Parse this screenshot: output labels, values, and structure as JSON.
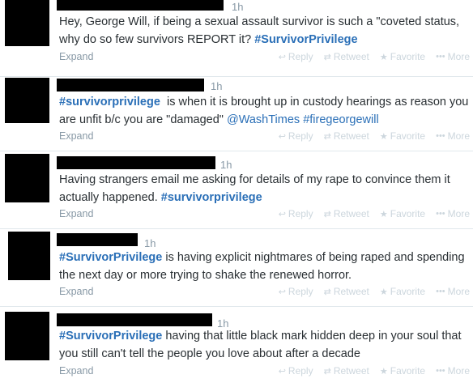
{
  "actions": {
    "reply": "Reply",
    "retweet": "Retweet",
    "favorite": "Favorite",
    "more": "More",
    "expand": "Expand"
  },
  "tweets": [
    {
      "time": "1h",
      "parts": [
        {
          "t": "Hey, George Will, if being a sexual assault survivor is such a \"coveted status,",
          "k": "text"
        },
        {
          "t": "why do so few survivors REPORT it? ",
          "k": "text"
        },
        {
          "t": "#SurvivorPrivilege",
          "k": "hash"
        }
      ]
    },
    {
      "time": "1h",
      "parts": [
        {
          "t": "#survivorprivilege",
          "k": "hash"
        },
        {
          "t": "  is when it is brought up in custody hearings as reason you",
          "k": "text"
        },
        {
          "t": "are unfit b/c you are \"damaged\" ",
          "k": "text"
        },
        {
          "t": "@WashTimes",
          "k": "mention"
        },
        {
          "t": " ",
          "k": "text"
        },
        {
          "t": "#firegeorgewill",
          "k": "mention"
        }
      ]
    },
    {
      "time": "1h",
      "parts": [
        {
          "t": "Having strangers email me asking for details of my rape to convince them it",
          "k": "text"
        },
        {
          "t": "actually happened. ",
          "k": "text"
        },
        {
          "t": "#survivorprivilege",
          "k": "hash"
        }
      ]
    },
    {
      "time": "1h",
      "parts": [
        {
          "t": "#SurvivorPrivilege",
          "k": "hash"
        },
        {
          "t": " is having explicit nightmares of being raped and spending",
          "k": "text"
        },
        {
          "t": "the next day or more trying to shake the renewed horror.",
          "k": "text"
        }
      ]
    },
    {
      "time": "1h",
      "parts": [
        {
          "t": "#SurvivorPrivilege",
          "k": "hash"
        },
        {
          "t": " having that little black mark hidden deep in your soul that",
          "k": "text"
        },
        {
          "t": "you still can't tell the people you love about after a decade",
          "k": "text"
        }
      ]
    }
  ]
}
